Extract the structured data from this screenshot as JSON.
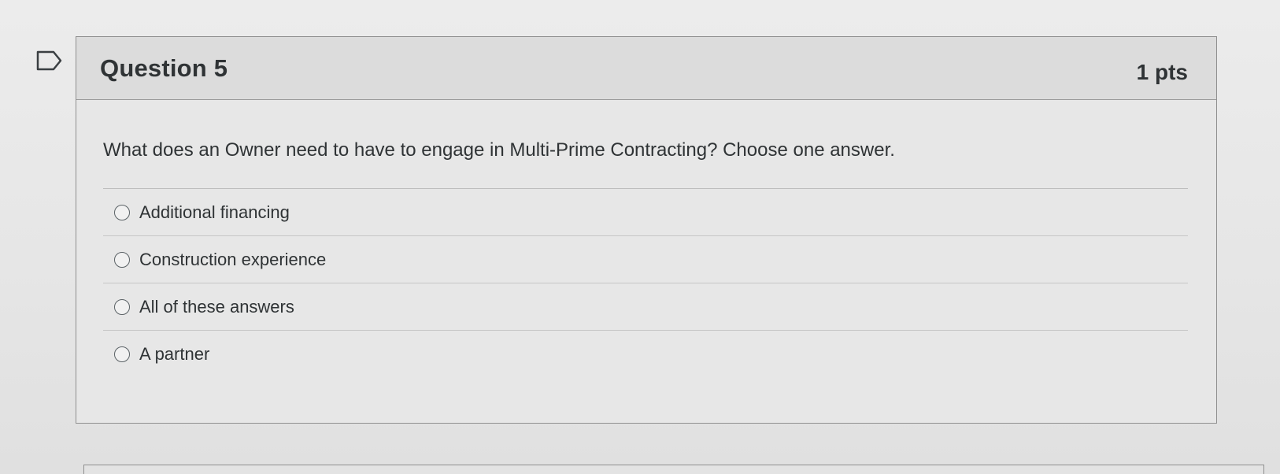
{
  "question": {
    "title": "Question 5",
    "points": "1 pts",
    "text": "What does an Owner need to have to engage in Multi-Prime Contracting? Choose one answer.",
    "answers": [
      {
        "label": "Additional financing",
        "selected": false
      },
      {
        "label": "Construction experience",
        "selected": false
      },
      {
        "label": "All of these answers",
        "selected": false
      },
      {
        "label": "A partner",
        "selected": false
      }
    ]
  },
  "icons": {
    "flag": "flag-outline-icon"
  },
  "colors": {
    "header_background": "#dcdcdc",
    "card_background": "#e7e7e7",
    "text": "#2f3335",
    "border": "#8f8f8f"
  }
}
